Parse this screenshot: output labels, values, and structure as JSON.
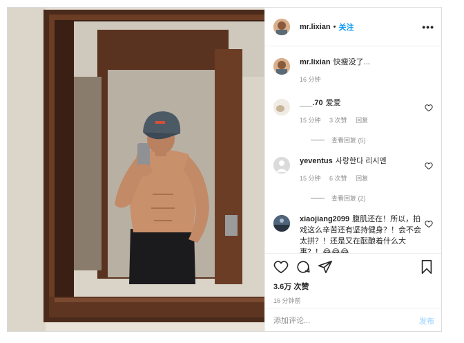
{
  "post": {
    "photo": {
      "subject": "mirror selfie"
    },
    "header": {
      "username": "mr.lixian",
      "separator": "•",
      "follow_label": "关注",
      "more_icon": "more-horizontal-icon"
    },
    "caption": {
      "username": "mr.lixian",
      "text": "快瘦没了...",
      "time": "16 分钟"
    },
    "comments": [
      {
        "username": "___.70",
        "text": "爱爱",
        "time": "15 分钟",
        "likes": "3 次赞",
        "reply": "回复",
        "view_replies": "查看回复 (5)"
      },
      {
        "username": "yeventus",
        "text": "사랑한다 리시엔",
        "time": "15 分钟",
        "likes": "6 次赞",
        "reply": "回复",
        "view_replies": "查看回复 (2)"
      },
      {
        "username": "xiaojiang2099",
        "text": "腹肌还在！所以，拍戏这么辛苦还有坚持健身？！会不会太拼？！还是又在酝酿着什么大事？！😂😂😂"
      }
    ],
    "actions": {
      "likes": "3.6万 次赞",
      "time": "16 分钟前"
    },
    "composer": {
      "placeholder": "添加评论...",
      "post_label": "发布"
    },
    "colors": {
      "accent": "#0095f6",
      "muted": "#8e8e8e",
      "post_disabled": "#b3dbff"
    }
  }
}
